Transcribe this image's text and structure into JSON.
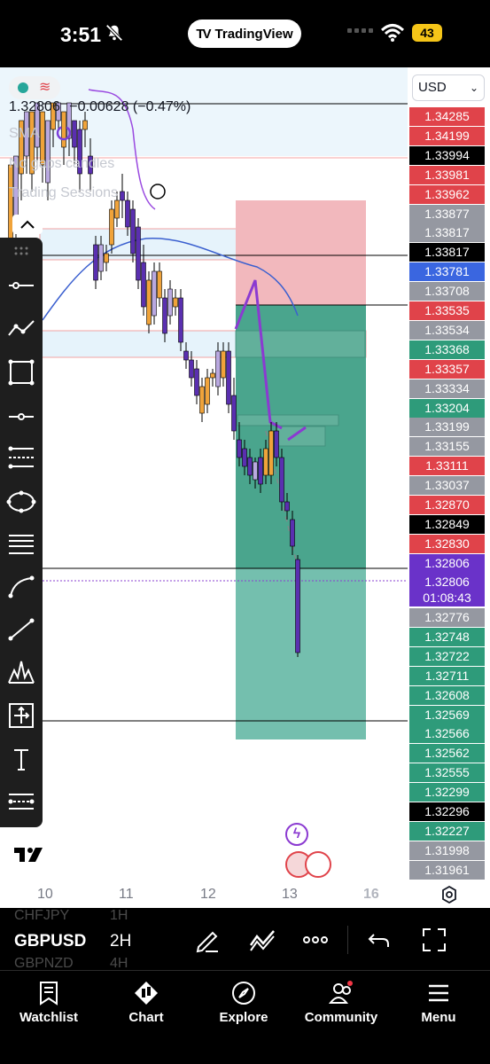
{
  "status": {
    "time": "3:51",
    "app_pill": "TradingView",
    "battery": "43"
  },
  "chart": {
    "currency": "USD",
    "legend": {
      "price": "1.32806",
      "change": "−0.00628 (−0.47%)",
      "indicators": [
        "SMA",
        "No gaps candles",
        "Trading Sessions"
      ]
    },
    "price_labels": [
      {
        "v": "1.34285",
        "c": "#e0434a"
      },
      {
        "v": "1.34199",
        "c": "#e0434a"
      },
      {
        "v": "1.33994",
        "c": "#000000"
      },
      {
        "v": "1.33981",
        "c": "#e0434a"
      },
      {
        "v": "1.33962",
        "c": "#e0434a"
      },
      {
        "v": "1.33877",
        "c": "#9598a1"
      },
      {
        "v": "1.33817",
        "c": "#9598a1"
      },
      {
        "v": "1.33817",
        "c": "#000000"
      },
      {
        "v": "1.33781",
        "c": "#3a66e0"
      },
      {
        "v": "1.33708",
        "c": "#9598a1"
      },
      {
        "v": "1.33535",
        "c": "#e0434a"
      },
      {
        "v": "1.33534",
        "c": "#9598a1"
      },
      {
        "v": "1.33368",
        "c": "#2e9b7a"
      },
      {
        "v": "1.33357",
        "c": "#e0434a"
      },
      {
        "v": "1.33334",
        "c": "#9598a1"
      },
      {
        "v": "1.33204",
        "c": "#2e9b7a"
      },
      {
        "v": "1.33199",
        "c": "#9598a1"
      },
      {
        "v": "1.33155",
        "c": "#9598a1"
      },
      {
        "v": "1.33111",
        "c": "#e0434a"
      },
      {
        "v": "1.33037",
        "c": "#9598a1"
      },
      {
        "v": "1.32870",
        "c": "#e0434a"
      },
      {
        "v": "1.32849",
        "c": "#000000"
      },
      {
        "v": "1.32830",
        "c": "#e0434a"
      },
      {
        "v": "1.32806",
        "c": "#6a32c9"
      }
    ],
    "current_price": {
      "v": "1.32806",
      "countdown": "01:08:43",
      "c": "#6a32c9"
    },
    "price_labels_lower": [
      {
        "v": "1.32776",
        "c": "#9598a1"
      },
      {
        "v": "1.32748",
        "c": "#2e9b7a"
      },
      {
        "v": "1.32722",
        "c": "#2e9b7a"
      },
      {
        "v": "1.32711",
        "c": "#2e9b7a"
      },
      {
        "v": "1.32608",
        "c": "#2e9b7a"
      },
      {
        "v": "1.32569",
        "c": "#2e9b7a"
      },
      {
        "v": "1.32566",
        "c": "#2e9b7a"
      },
      {
        "v": "1.32562",
        "c": "#2e9b7a"
      },
      {
        "v": "1.32555",
        "c": "#2e9b7a"
      },
      {
        "v": "1.32299",
        "c": "#2e9b7a"
      },
      {
        "v": "1.32296",
        "c": "#000000"
      },
      {
        "v": "1.32227",
        "c": "#2e9b7a"
      },
      {
        "v": "1.31998",
        "c": "#9598a1"
      },
      {
        "v": "1.31961",
        "c": "#9598a1"
      }
    ],
    "time_labels": [
      "10",
      "11",
      "12",
      "13",
      "16"
    ]
  },
  "toolbar": {
    "symbol": "GBPUSD",
    "timeframe": "2H",
    "ghost_above": [
      "CHFJPY",
      "1H"
    ],
    "ghost_below": [
      "GBPNZD",
      "4H"
    ]
  },
  "tabs": [
    "Watchlist",
    "Chart",
    "Explore",
    "Community",
    "Menu"
  ]
}
